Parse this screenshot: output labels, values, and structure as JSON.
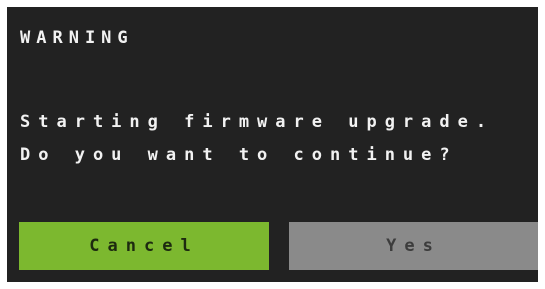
{
  "dialog": {
    "title": "WARNING",
    "message_lines": [
      "Starting firmware upgrade.",
      "Do you want to continue?"
    ]
  },
  "buttons": {
    "cancel_label": "Cancel",
    "yes_label": "Yes"
  },
  "colors": {
    "screen_background": "#222222",
    "text": "#f2f2f2",
    "cancel_button": "#7cb82f",
    "yes_button": "#8a8a8a"
  }
}
